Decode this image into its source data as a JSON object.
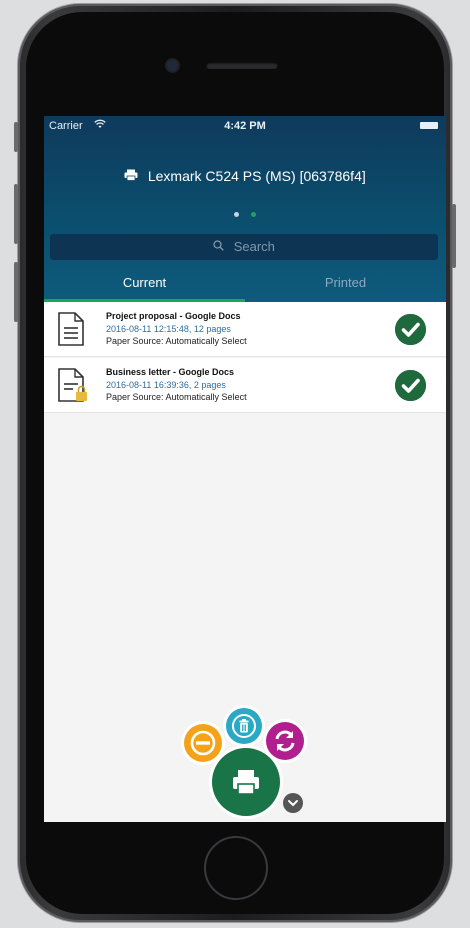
{
  "status_bar": {
    "carrier": "Carrier",
    "wifi_icon": "wifi-icon",
    "time": "4:42 PM",
    "battery_icon": "battery-icon"
  },
  "header": {
    "printer_icon": "printer-icon",
    "printer_name": "Lexmark C524 PS (MS) [063786f4]",
    "page_dots": {
      "total": 2,
      "active_index": 1
    }
  },
  "search": {
    "icon": "search-icon",
    "placeholder": "Search"
  },
  "tabs": [
    {
      "label": "Current",
      "selected": true
    },
    {
      "label": "Printed",
      "selected": false
    }
  ],
  "jobs": [
    {
      "title": "Project proposal - Google Docs",
      "meta": "2016-08-11 12:15:48, 12 pages",
      "source": "Paper Source: Automatically Select",
      "icon": "document-icon",
      "status_icon": "check-icon"
    },
    {
      "title": "Business letter - Google Docs",
      "meta": "2016-08-11 16:39:36, 2 pages",
      "source": "Paper Source: Automatically Select",
      "icon": "document-locked-icon",
      "status_icon": "check-icon"
    }
  ],
  "actions": {
    "remove_icon": "minus-icon",
    "delete_icon": "trash-icon",
    "refresh_icon": "refresh-icon",
    "print_icon": "printer-icon",
    "more_icon": "chevron-down-icon"
  },
  "colors": {
    "header_top": "#0f3a5c",
    "header_bottom": "#0e5b7d",
    "tab_accent": "#21a35a",
    "status_ok": "#1f6a3d",
    "link_blue": "#2d6da3",
    "fab_orange": "#f5a21b",
    "fab_cyan": "#2aa8c6",
    "fab_magenta": "#b11e8e",
    "fab_green": "#197547"
  }
}
